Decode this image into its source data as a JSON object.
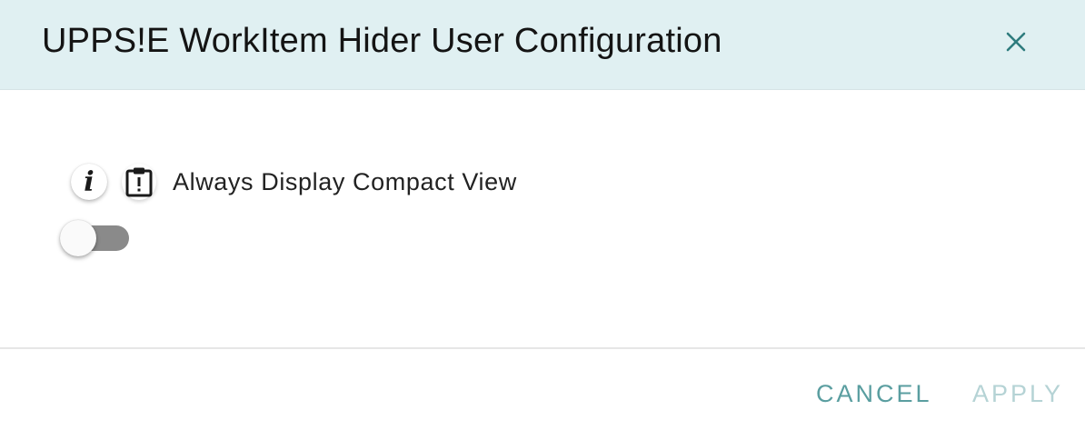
{
  "dialog": {
    "title": "UPPS!E WorkItem Hider User Configuration",
    "header_bg": "#e0f0f2",
    "close_icon": "close-icon"
  },
  "setting": {
    "info_icon": "info-icon",
    "info_glyph": "i",
    "clipboard_icon": "clipboard-alert-icon",
    "label": "Always Display Compact View",
    "toggle_on": false
  },
  "footer": {
    "cancel_label": "CANCEL",
    "apply_label": "APPLY",
    "apply_enabled": false,
    "accent_color": "#5a9ea0",
    "disabled_color": "#b5d3d5"
  }
}
